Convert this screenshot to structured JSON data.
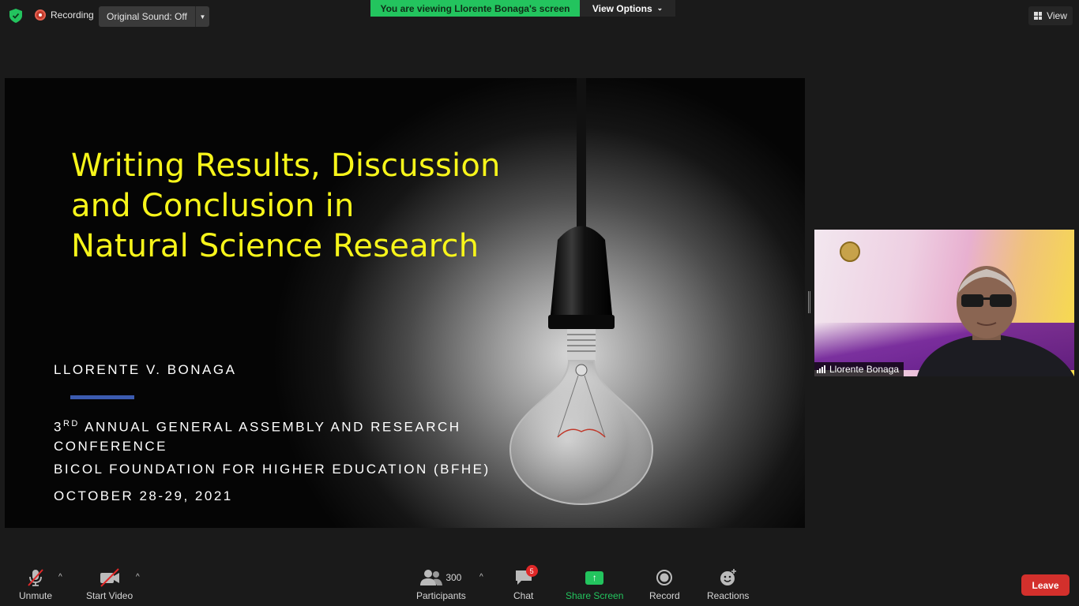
{
  "topbar": {
    "recording_label": "Recording",
    "original_sound_label": "Original Sound: Off",
    "viewing_banner": "You are viewing Llorente Bonaga's screen",
    "view_options_label": "View Options",
    "view_label": "View"
  },
  "slide": {
    "title_lines": [
      "Writing Results, Discussion",
      "and Conclusion in",
      "Natural Science Research"
    ],
    "author": "LLORENTE V. BONAGA",
    "conference_ord": "3",
    "conference_sup": "RD",
    "conference_line1": " ANNUAL GENERAL ASSEMBLY AND RESEARCH",
    "conference_line2": "CONFERENCE",
    "organization": "BICOL FOUNDATION FOR HIGHER EDUCATION (BFHE)",
    "date": "OCTOBER 28-29, 2021"
  },
  "participant_video": {
    "name": "Llorente Bonaga"
  },
  "toolbar": {
    "unmute_label": "Unmute",
    "start_video_label": "Start Video",
    "participants_count": "300",
    "participants_label": "Participants",
    "chat_badge": "5",
    "chat_label": "Chat",
    "share_screen_label": "Share Screen",
    "record_label": "Record",
    "reactions_label": "Reactions",
    "leave_label": "Leave"
  },
  "colors": {
    "banner_green": "#23c45e",
    "title_yellow": "#f7f51a",
    "leave_red": "#d3302c",
    "accent_blue": "#3c5bb0"
  }
}
